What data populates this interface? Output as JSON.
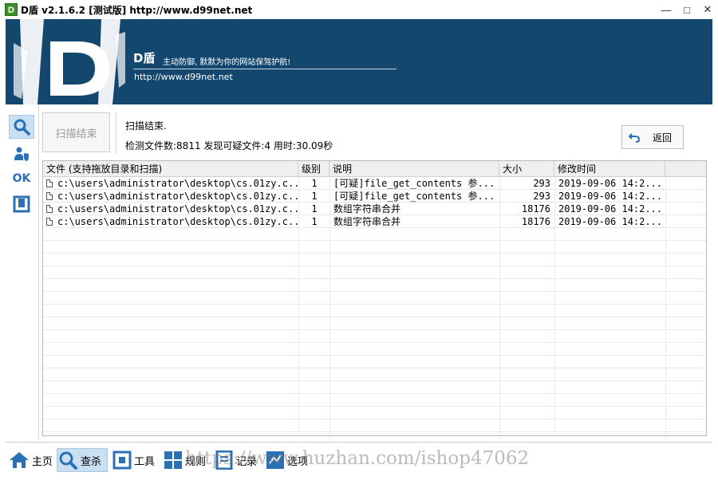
{
  "window": {
    "app_icon_text": "D",
    "title": "D盾 v2.1.6.2 [测试版] http://www.d99net.net",
    "minimize": "—",
    "maximize": "□",
    "close": "✕"
  },
  "banner": {
    "logo_text": "D",
    "name": "D盾",
    "slogan": "主动防御, 默默为你的网站保驾护航!",
    "url": "http://www.d99net.net",
    "bg_color": "#13476e"
  },
  "left_toolbar": {
    "items": [
      {
        "icon": "search-icon",
        "active": true
      },
      {
        "icon": "shield-person-icon",
        "active": false
      },
      {
        "icon": "ok-icon",
        "text": "OK",
        "active": false
      },
      {
        "icon": "frame-icon",
        "active": false
      }
    ]
  },
  "scan": {
    "scan_button": "扫描结束",
    "status_title": "扫描结束.",
    "status_detail": "检测文件数:8811 发现可疑文件:4 用时:30.09秒",
    "back_button": "返回"
  },
  "table": {
    "columns": [
      "文件 (支持拖放目录和扫描)",
      "级别",
      "说明",
      "大小",
      "修改时间"
    ],
    "rows": [
      {
        "file": "c:\\users\\administrator\\desktop\\cs.01zy.c...",
        "level": "1",
        "desc": "[可疑]file_get_contents 参...",
        "size": "293",
        "time": "2019-09-06 14:2..."
      },
      {
        "file": "c:\\users\\administrator\\desktop\\cs.01zy.c...",
        "level": "1",
        "desc": "[可疑]file_get_contents 参...",
        "size": "293",
        "time": "2019-09-06 14:2..."
      },
      {
        "file": "c:\\users\\administrator\\desktop\\cs.01zy.c...",
        "level": "1",
        "desc": "数组字符串合并",
        "size": "18176",
        "time": "2019-09-06 14:2..."
      },
      {
        "file": "c:\\users\\administrator\\desktop\\cs.01zy.c...",
        "level": "1",
        "desc": "数组字符串合并",
        "size": "18176",
        "time": "2019-09-06 14:2..."
      }
    ]
  },
  "bottom_nav": {
    "items": [
      {
        "label": "主页",
        "icon": "home-icon",
        "active": false
      },
      {
        "label": "查杀",
        "icon": "search-icon",
        "active": true
      },
      {
        "label": "工具",
        "icon": "tools-icon",
        "active": false
      },
      {
        "label": "规则",
        "icon": "rules-icon",
        "active": false
      },
      {
        "label": "记录",
        "icon": "log-icon",
        "active": false
      },
      {
        "label": "选项",
        "icon": "options-icon",
        "active": false
      }
    ]
  },
  "watermark": "https://www.huzhan.com/ishop47062",
  "colors": {
    "accent": "#2b6fb5",
    "active_bg": "#c9dff2"
  }
}
